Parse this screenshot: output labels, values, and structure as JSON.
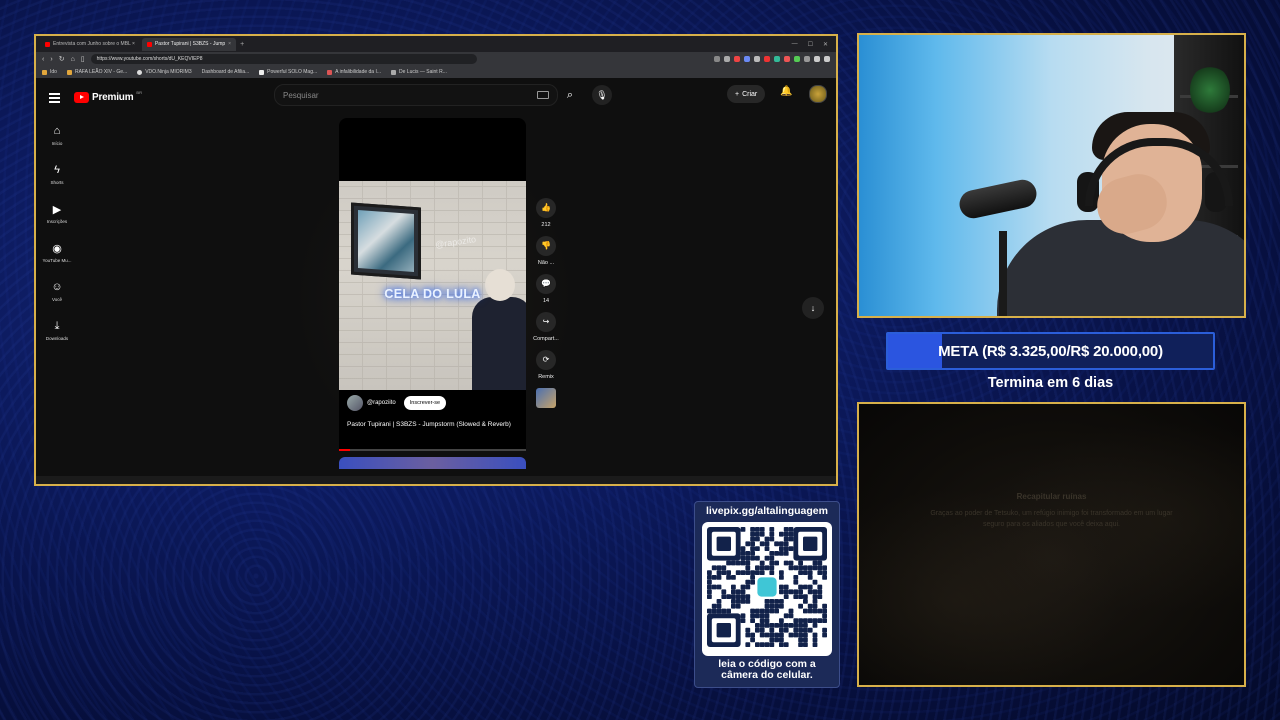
{
  "browser": {
    "tabs": [
      {
        "label": "Entrevista com Junho sobre o MBL ×",
        "active": false
      },
      {
        "label": "Pastor Tupirani | S3BZS - Jump",
        "active": true
      }
    ],
    "url": "https://www.youtube.com/shorts/dU_KEQVIEP8",
    "bookmarks": [
      "Ido",
      "RAFA LEÃO XIV - Ge...",
      "VDO.Ninja MIORIM3",
      "Dashboard de Afilia...",
      "Powerful SOLO Mag...",
      "A infalibilidade da I...",
      "De Lucis — Saint R..."
    ]
  },
  "youtube": {
    "logo_text": "Premium",
    "logo_sup": "BR",
    "search_placeholder": "Pesquisar",
    "create_label": "Criar",
    "sidebar": [
      {
        "icon": "home-icon",
        "glyph": "⌂",
        "label": "Início"
      },
      {
        "icon": "shorts-icon",
        "glyph": "ϟ",
        "label": "Shorts"
      },
      {
        "icon": "subscriptions-icon",
        "glyph": "▶",
        "label": "Inscrições"
      },
      {
        "icon": "youtube-music-icon",
        "glyph": "◉",
        "label": "YouTube Mu..."
      },
      {
        "icon": "you-icon",
        "glyph": "☺",
        "label": "Você"
      },
      {
        "icon": "downloads-icon",
        "glyph": "⤓",
        "label": "Downloads"
      }
    ],
    "short": {
      "caption": "CELA DO LULA",
      "watermark": "@rapozito",
      "channel": "@rapoziito",
      "subscribe_label": "Inscrever-se",
      "title": "Pastor Tupirani | S3BZS - Jumpstorm (Slowed & Reverb)",
      "progress": 0.06
    },
    "actions": [
      {
        "icon": "like-icon",
        "glyph": "👍",
        "label": "212"
      },
      {
        "icon": "dislike-icon",
        "glyph": "👎",
        "label": "Não ..."
      },
      {
        "icon": "comment-icon",
        "glyph": "💬",
        "label": "14"
      },
      {
        "icon": "share-icon",
        "glyph": "↪",
        "label": "Compart..."
      },
      {
        "icon": "remix-icon",
        "glyph": "⟳",
        "label": "Remix"
      }
    ]
  },
  "overlay": {
    "meta_text": "META (R$ 3.325,00/R$ 20.000,00)",
    "meta_progress": 0.166,
    "termina_text": "Termina em 6 dias",
    "qr_url": "livepix.gg/altalinguagem",
    "qr_caption_1": "leia o código com a",
    "qr_caption_2": "câmera do celular.",
    "game_title": "Recapitular ruínas",
    "game_body": "Graças ao poder de Tetsuko, um refúgio inimigo foi transformado em um lugar seguro para os aliados que você deixa aqui.",
    "colors": {
      "frame": "#d7b04a",
      "meta_bar": "#2b55e0",
      "youtube_red": "#ff0000"
    }
  }
}
